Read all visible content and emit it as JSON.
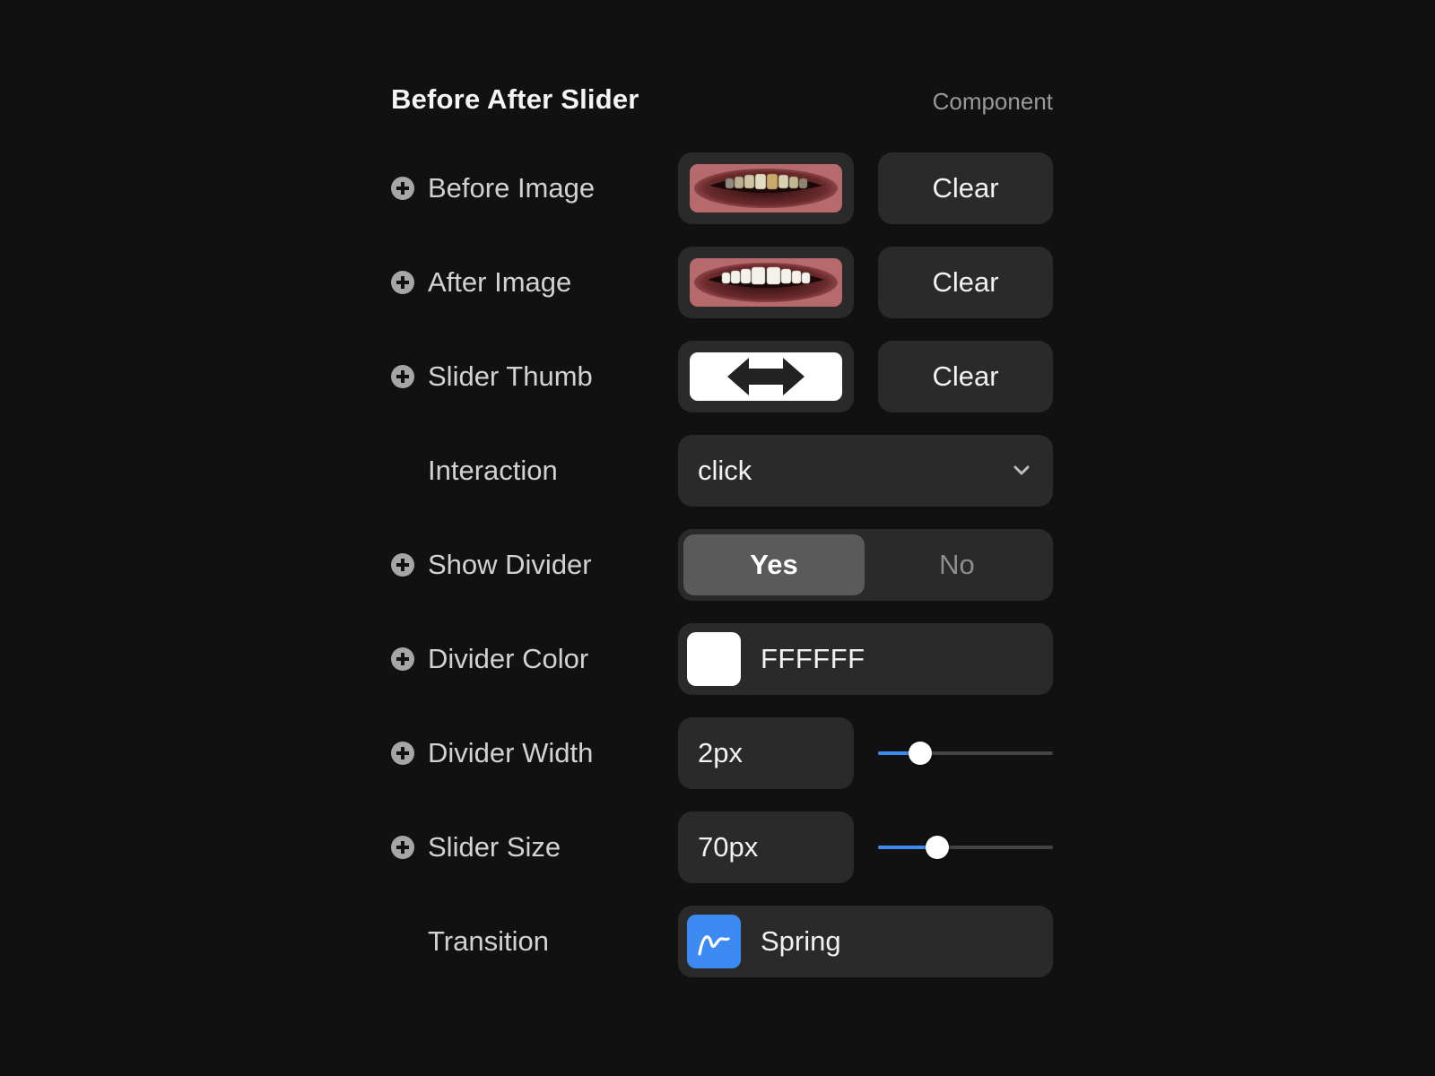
{
  "panel": {
    "title": "Before After Slider",
    "subtitle": "Component"
  },
  "rows": {
    "before_image": {
      "label": "Before Image",
      "clear_label": "Clear",
      "icon": "plus-circle-icon"
    },
    "after_image": {
      "label": "After Image",
      "clear_label": "Clear",
      "icon": "plus-circle-icon"
    },
    "slider_thumb": {
      "label": "Slider Thumb",
      "clear_label": "Clear",
      "icon": "plus-circle-icon",
      "thumb_icon": "double-arrow-icon"
    },
    "interaction": {
      "label": "Interaction",
      "value": "click",
      "icon": "chevron-down-icon"
    },
    "show_divider": {
      "label": "Show Divider",
      "options": [
        "Yes",
        "No"
      ],
      "selected": "Yes",
      "icon": "plus-circle-icon"
    },
    "divider_color": {
      "label": "Divider Color",
      "value": "FFFFFF",
      "swatch_color": "#FFFFFF",
      "icon": "plus-circle-icon"
    },
    "divider_width": {
      "label": "Divider Width",
      "value": "2px",
      "slider_level": 0.24,
      "icon": "plus-circle-icon"
    },
    "slider_size": {
      "label": "Slider Size",
      "value": "70px",
      "slider_level": 0.34,
      "icon": "plus-circle-icon"
    },
    "transition": {
      "label": "Transition",
      "value": "Spring",
      "icon": "spring-curve-icon"
    }
  },
  "colors": {
    "background": "#111111",
    "control": "#2A2A2A",
    "accent": "#3D8BF2",
    "segment_selected": "#5A5A5A"
  }
}
